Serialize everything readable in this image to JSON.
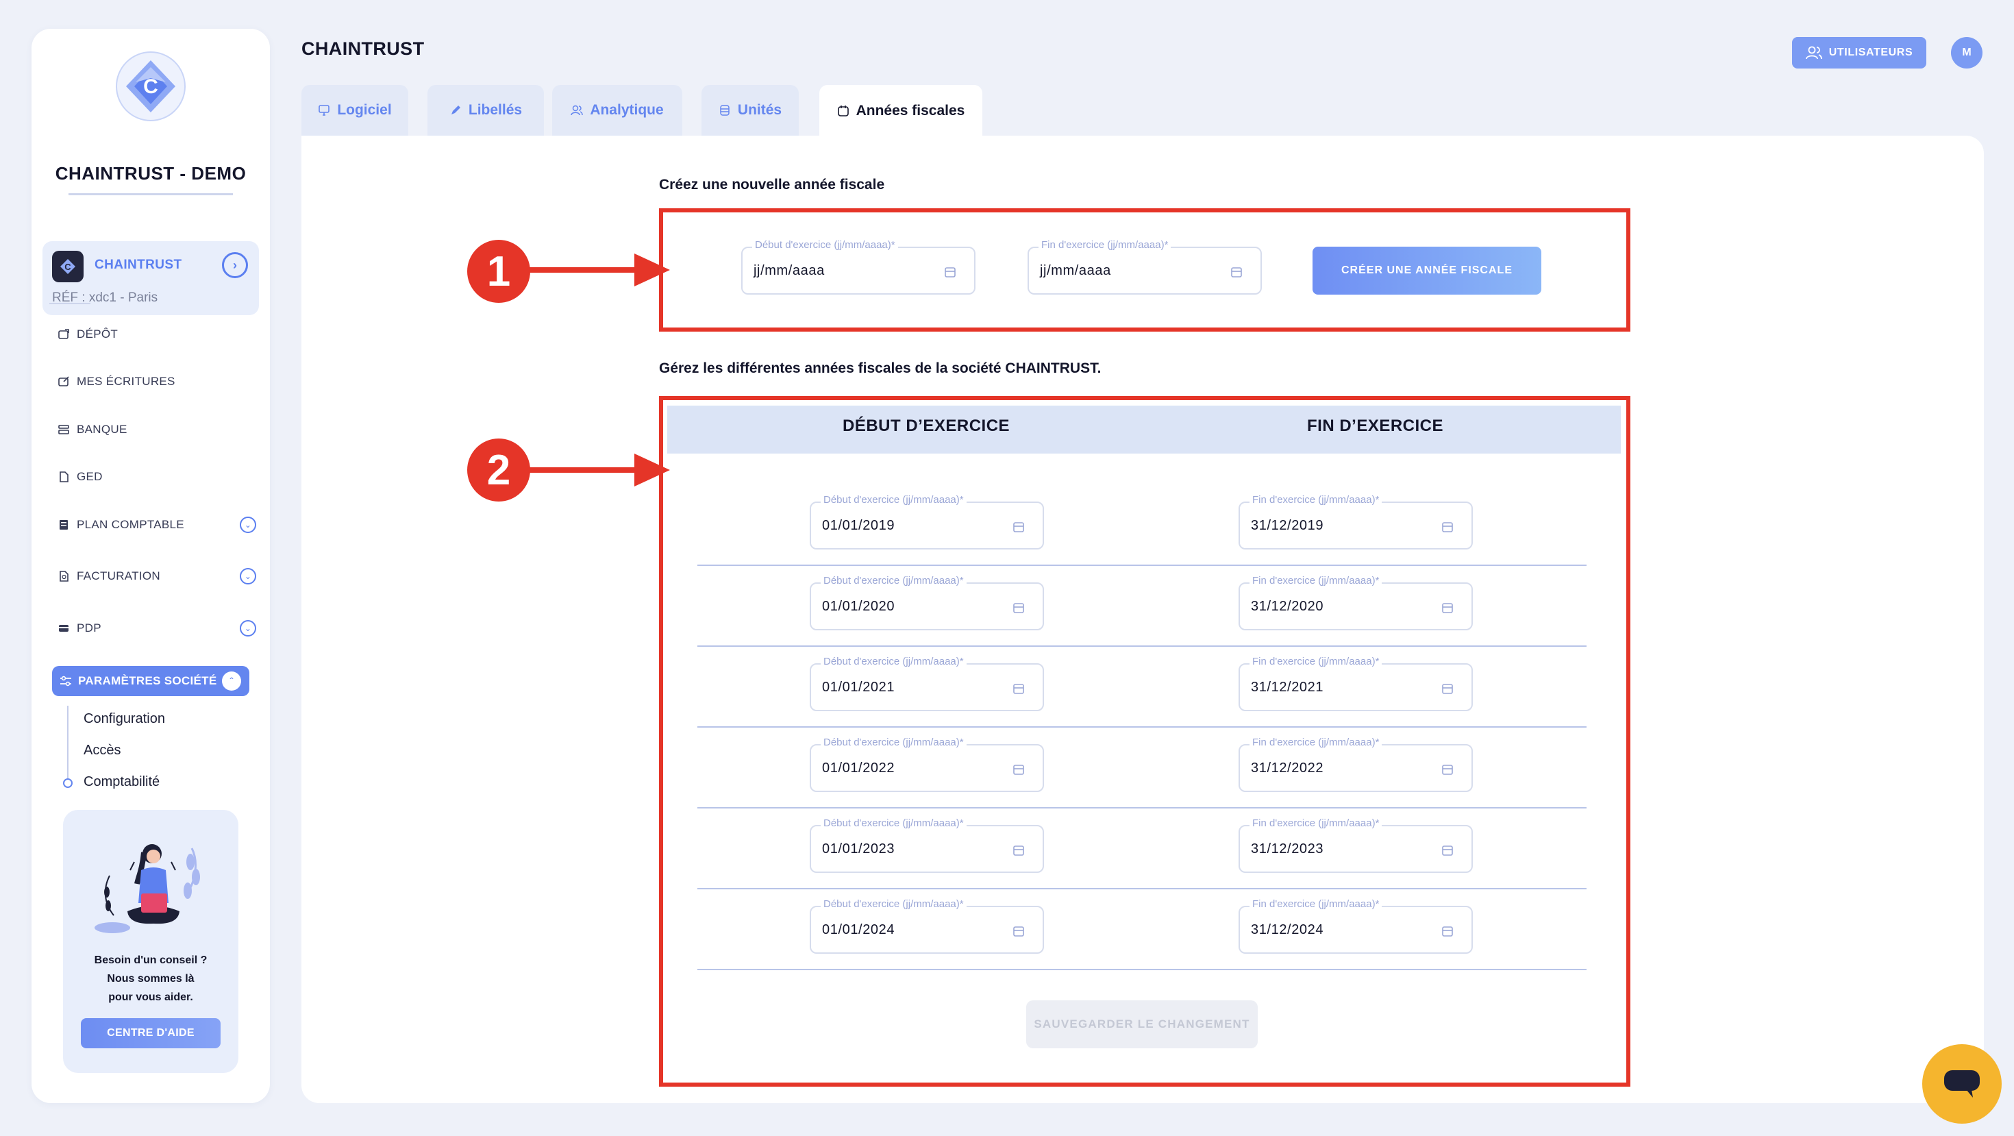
{
  "sidebar": {
    "company_name": "CHAINTRUST - DEMO",
    "company_card": {
      "name": "CHAINTRUST",
      "ref": "RÉF : xdc1 - Paris"
    },
    "nav": [
      {
        "label": "DÉPÔT",
        "icon": "upload-icon"
      },
      {
        "label": "MES ÉCRITURES",
        "icon": "edit-icon"
      },
      {
        "label": "BANQUE",
        "icon": "bank-icon"
      },
      {
        "label": "GED",
        "icon": "document-icon"
      },
      {
        "label": "PLAN COMPTABLE",
        "icon": "ledger-icon"
      },
      {
        "label": "FACTURATION",
        "icon": "invoice-icon"
      },
      {
        "label": "PDP",
        "icon": "card-icon"
      }
    ],
    "active_section": "PARAMÈTRES SOCIÉTÉ",
    "sub_items": [
      "Configuration",
      "Accès",
      "Comptabilité"
    ],
    "help": {
      "text_lines": [
        "Besoin d'un conseil ?",
        "Nous sommes là",
        "pour vous aider."
      ],
      "button": "CENTRE D'AIDE"
    }
  },
  "header": {
    "title": "CHAINTRUST",
    "users_button": "UTILISATEURS",
    "avatar_initial": "M"
  },
  "tabs": [
    {
      "label": "Logiciel",
      "icon": "monitor-icon",
      "active": false
    },
    {
      "label": "Libellés",
      "icon": "pen-icon",
      "active": false
    },
    {
      "label": "Analytique",
      "icon": "users-icon",
      "active": false
    },
    {
      "label": "Unités",
      "icon": "database-icon",
      "active": false
    },
    {
      "label": "Années fiscales",
      "icon": "calendar-outline-icon",
      "active": true
    }
  ],
  "create_section": {
    "title": "Créez une nouvelle année fiscale",
    "start_label": "Début d'exercice (jj/mm/aaaa)*",
    "end_label": "Fin d'exercice (jj/mm/aaaa)*",
    "start_value": "jj/mm/aaaa",
    "end_value": "jj/mm/aaaa",
    "button": "CRÉER UNE ANNÉE FISCALE"
  },
  "manage_section": {
    "title": "Gérez les différentes années fiscales de la société CHAINTRUST.",
    "columns": [
      "DÉBUT D’EXERCICE",
      "FIN D’EXERCICE"
    ],
    "start_label": "Début d'exercice (jj/mm/aaaa)*",
    "end_label": "Fin d'exercice (jj/mm/aaaa)*",
    "rows": [
      {
        "start": "01/01/2019",
        "end": "31/12/2019"
      },
      {
        "start": "01/01/2020",
        "end": "31/12/2020"
      },
      {
        "start": "01/01/2021",
        "end": "31/12/2021"
      },
      {
        "start": "01/01/2022",
        "end": "31/12/2022"
      },
      {
        "start": "01/01/2023",
        "end": "31/12/2023"
      },
      {
        "start": "01/01/2024",
        "end": "31/12/2024"
      }
    ],
    "save_button": "SAUVEGARDER LE CHANGEMENT"
  },
  "annotations": {
    "marker_1": "1",
    "marker_2": "2"
  },
  "colors": {
    "accent": "#6486ef",
    "annotation_red": "#e53528",
    "chat": "#f5b52e",
    "background": "#eef1f9"
  }
}
